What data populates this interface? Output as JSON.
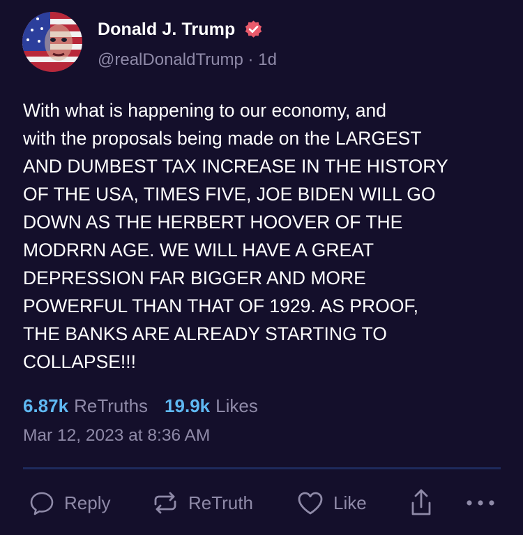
{
  "post": {
    "display_name": "Donald J. Trump",
    "handle_time": "@realDonaldTrump · 1d",
    "body": "With what is happening to our economy, and\nwith the proposals being made on the LARGEST\nAND DUMBEST TAX INCREASE IN THE HISTORY\nOF THE USA, TIMES FIVE, JOE BIDEN WILL GO\nDOWN AS THE HERBERT HOOVER OF THE\nMODRRN AGE. WE WILL HAVE A GREAT\nDEPRESSION FAR BIGGER AND MORE\nPOWERFUL THAN THAT OF 1929. AS PROOF,\nTHE BANKS ARE ALREADY STARTING TO\nCOLLAPSE!!!",
    "retruths_count": "6.87k",
    "retruths_label": "ReTruths",
    "likes_count": "19.9k",
    "likes_label": "Likes",
    "timestamp": "Mar 12, 2023 at 8:36 AM"
  },
  "actions": {
    "reply_label": "Reply",
    "retruth_label": "ReTruth",
    "like_label": "Like"
  },
  "icons": {
    "verified": "verified-badge-icon",
    "reply": "speech-bubble-icon",
    "retruth": "repost-arrows-icon",
    "like": "heart-icon",
    "share": "share-upload-icon",
    "more": "more-dots-icon"
  },
  "colors": {
    "background": "#140f2b",
    "accent": "#5fb8f2",
    "muted": "#8f8aa8",
    "verified": "#e85a6b"
  }
}
